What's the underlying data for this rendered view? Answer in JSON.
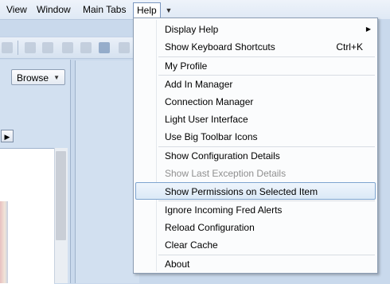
{
  "menubar": {
    "items": [
      {
        "label": "View"
      },
      {
        "label": "Window"
      },
      {
        "label": "Main Tabs"
      },
      {
        "label": "Help"
      }
    ],
    "active": "Help"
  },
  "left_panel": {
    "browse_label": "Browse"
  },
  "help_menu": {
    "items": [
      {
        "label": "Display Help",
        "has_submenu": true
      },
      {
        "label": "Show Keyboard Shortcuts",
        "shortcut": "Ctrl+K"
      },
      {
        "label": "My Profile"
      },
      {
        "label": "Add In Manager"
      },
      {
        "label": "Connection Manager"
      },
      {
        "label": "Light User Interface"
      },
      {
        "label": "Use Big Toolbar Icons"
      },
      {
        "label": "Show Configuration Details"
      },
      {
        "label": "Show Last Exception Details",
        "disabled": true
      },
      {
        "label": "Show Permissions on Selected Item",
        "selected": true
      },
      {
        "label": "Ignore Incoming Fred Alerts"
      },
      {
        "label": "Reload Configuration"
      },
      {
        "label": "Clear Cache"
      },
      {
        "label": "About"
      }
    ]
  },
  "colors": {
    "selection_border": "#7ea4cf",
    "disabled_text": "#8f8f8f",
    "menu_background": "#fbfcfd"
  }
}
